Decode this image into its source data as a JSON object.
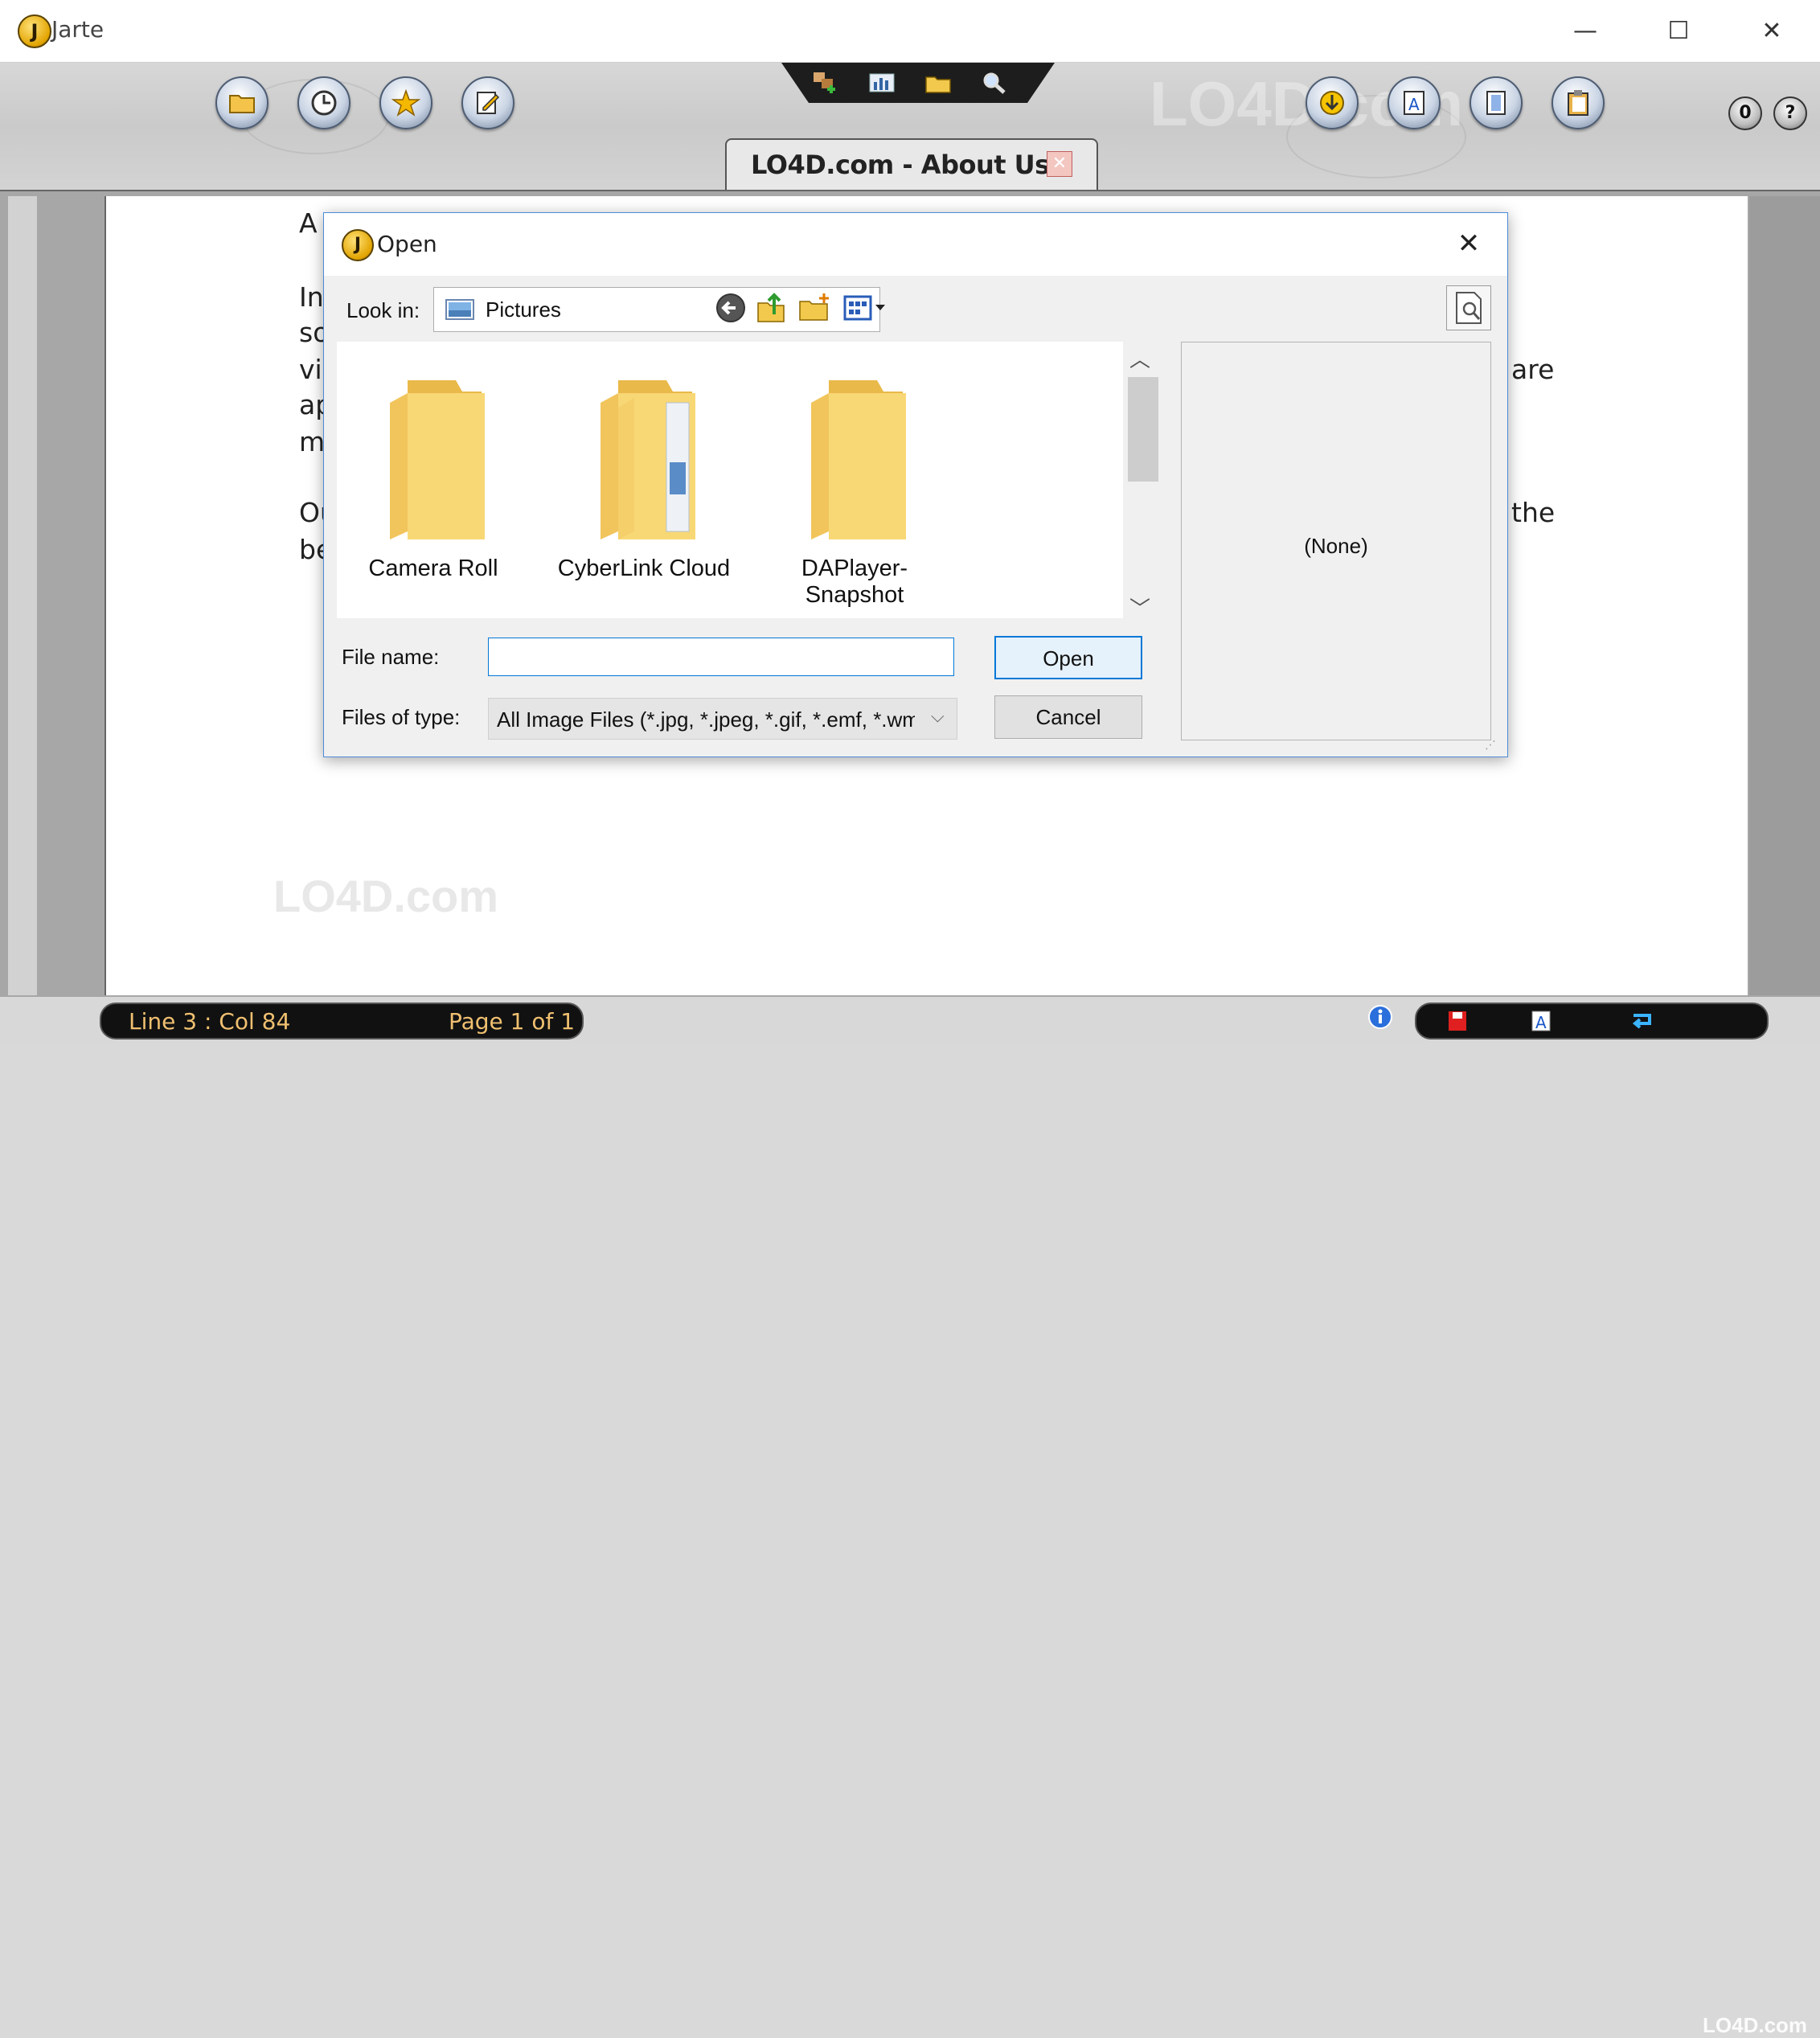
{
  "window": {
    "title": "Jarte",
    "logo_letter": "J",
    "controls": {
      "minimize": "—",
      "maximize": "☐",
      "close": "✕"
    }
  },
  "toolbar": {
    "left_buttons": [
      "folder-icon",
      "clock-icon",
      "star-icon",
      "edit-note-icon"
    ],
    "center_buttons": [
      "insert-icon",
      "chart-icon",
      "open-folder-icon",
      "find-icon"
    ],
    "right_buttons": [
      "download-icon",
      "format-icon",
      "page-icon",
      "clipboard-icon"
    ],
    "small_buttons": {
      "zero": "0",
      "help": "?"
    },
    "watermark": "LO4D.com"
  },
  "document_tab": {
    "label": "LO4D.com - About Us",
    "close_label": "✕"
  },
  "document": {
    "lines": [
      {
        "left": "A",
        "right": ""
      },
      {
        "left": "In",
        "right": ""
      },
      {
        "left": "so",
        "right": ""
      },
      {
        "left": "vi",
        "right": "are"
      },
      {
        "left": "ap",
        "right": ""
      },
      {
        "left": "m",
        "right": ""
      },
      {
        "left": "Ou",
        "right": "the"
      },
      {
        "left": "be",
        "right": ""
      }
    ],
    "watermark": "LO4D.com"
  },
  "dialog": {
    "title": "Open",
    "logo_letter": "J",
    "close_label": "✕",
    "look_in_label": "Look in:",
    "look_in_value": "Pictures",
    "nav_icons": [
      "back-icon",
      "up-folder-icon",
      "new-folder-icon",
      "view-menu-icon"
    ],
    "folders": [
      {
        "name": "Camera Roll"
      },
      {
        "name": "CyberLink Cloud"
      },
      {
        "name": "DAPlayer-Snapshot"
      }
    ],
    "preview_text": "(None)",
    "file_name_label": "File name:",
    "file_name_value": "",
    "files_of_type_label": "Files of type:",
    "files_of_type_value": "All Image Files (*.jpg, *.jpeg, *.gif, *.emf, *.wm",
    "open_button": "Open",
    "cancel_button": "Cancel"
  },
  "statusbar": {
    "position": "Line 3 : Col 84",
    "page": "Page 1 of 1",
    "icons": [
      "info-icon",
      "save-icon",
      "format-icon",
      "wrap-icon"
    ],
    "watermark": "LO4D.com"
  },
  "colors": {
    "accent": "#0078d7",
    "status_text": "#f0c070",
    "folder_yellow": "#f8d775"
  }
}
